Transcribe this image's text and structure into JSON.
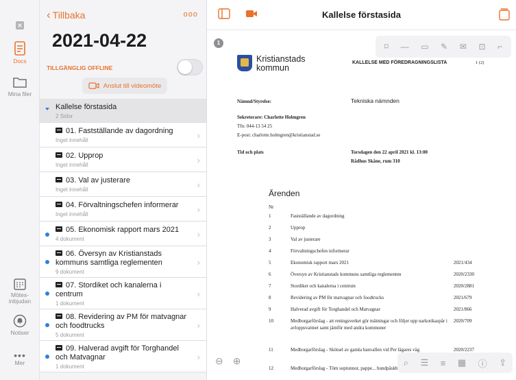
{
  "rail": {
    "docs_label": "Docs",
    "files_label": "Mina filer",
    "invite_label": "Mötes-\ninbjudan",
    "notices_label": "Notiser",
    "more_label": "Mer"
  },
  "list": {
    "back_label": "Tillbaka",
    "more_glyph": "ooo",
    "date": "2021-04-22",
    "offline_label": "TILLGÄNGLIG OFFLINE",
    "video_label": "Anslut till videomöte",
    "selected": {
      "title": "Kallelse förstasida",
      "sub": "2 Sidor"
    },
    "items": [
      {
        "title": "01. Fastställande av dagordning",
        "sub": "Inget innehåll",
        "dot": false
      },
      {
        "title": "02. Upprop",
        "sub": "Inget innehåll",
        "dot": false
      },
      {
        "title": "03. Val av justerare",
        "sub": "Inget innehåll",
        "dot": false
      },
      {
        "title": "04. Förvaltningschefen informerar",
        "sub": "Inget innehåll",
        "dot": false
      },
      {
        "title": "05. Ekonomisk rapport mars 2021",
        "sub": "4 dokument",
        "dot": true
      },
      {
        "title": "06. Översyn av Kristianstads kommuns samtliga reglementen",
        "sub": "9 dokument",
        "dot": true
      },
      {
        "title": "07. Stordiket och kanalerna i centrum",
        "sub": "1 dokument",
        "dot": true
      },
      {
        "title": "08. Revidering av PM för matvagnar och foodtrucks",
        "sub": "5 dokument",
        "dot": true
      },
      {
        "title": "09. Halverad avgift för Torghandel och Matvagnar",
        "sub": "1 dokument",
        "dot": true
      }
    ]
  },
  "doc": {
    "title": "Kallelse förstasida",
    "page_badge": "1",
    "org_line1": "Kristianstads",
    "org_line2": "kommun",
    "doc_type": "KALLELSE MED FÖREDRAGNINGSLISTA",
    "page_count": "1 (2)",
    "board_label": "Nämnd/Styrelse:",
    "board_value": "Tekniska nämnden",
    "secretary": "Sekreterare: Charlotte Holmgren",
    "phone": "Tfn: 044-13 54 25",
    "email": "E-post: charlotte.holmgren@kristianstad.se",
    "time_label": "Tid och plats",
    "time_value": "Torsdagen den 22 april 2021 kl. 13:00",
    "place_value": "Rådhus Skåne, rum 310",
    "arenden_heading": "Ärenden",
    "nr_label": "Nr",
    "agenda": [
      {
        "n": "1",
        "t": "Fastställande av dagordning",
        "c": ""
      },
      {
        "n": "2",
        "t": "Upprop",
        "c": ""
      },
      {
        "n": "3",
        "t": "Val av justerare",
        "c": ""
      },
      {
        "n": "4",
        "t": "Förvaltningschefen informerar",
        "c": ""
      },
      {
        "n": "5",
        "t": "Ekonomisk rapport mars 2021",
        "c": "2021/434"
      },
      {
        "n": "6",
        "t": "Översyn av Kristianstads kommuns samtliga reglementen",
        "c": "2020/2330"
      },
      {
        "n": "7",
        "t": "Stordiket och kanalerna i centrum",
        "c": "2020/2881"
      },
      {
        "n": "8",
        "t": "Revidering av PM för matvagnar och foodtrucks",
        "c": "2021/679"
      },
      {
        "n": "9",
        "t": "Halverad avgift för Torghandel och Matvagnar",
        "c": "2021/866"
      },
      {
        "n": "10",
        "t": "Medborgarförslag - att reningsverket gör mätningar och följer upp narkotikaspår i avloppsvattnet samt jämför med andra kommuner",
        "c": "2020/709"
      },
      {
        "n": "11",
        "t": "Medborgarförslag - Skötsel av gamla banvallen vid Per lägares väg",
        "c": "2020/2237"
      },
      {
        "n": "12",
        "t": "Medborgarförslag - Töm soptunnor, pappe... hundpåskbl... eftere",
        "c": ""
      }
    ]
  },
  "colors": {
    "accent": "#e8722c",
    "unread_dot": "#2f7fe0"
  }
}
